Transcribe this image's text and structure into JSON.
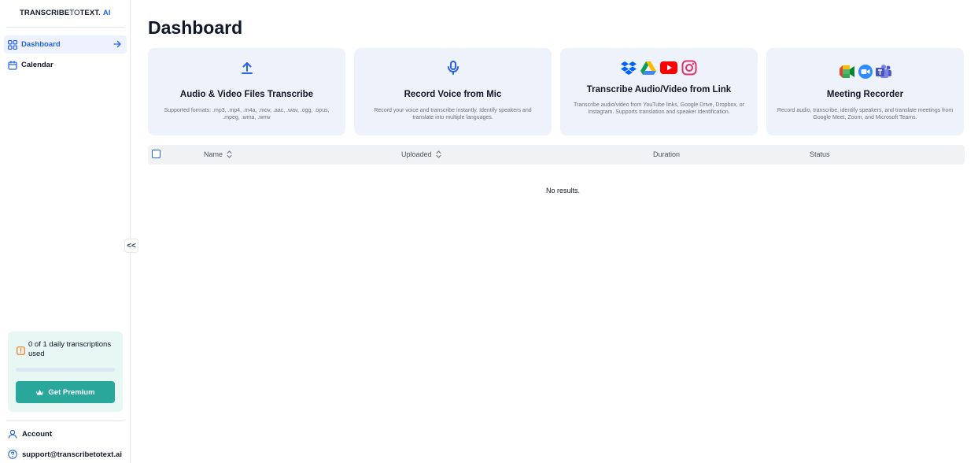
{
  "logo": {
    "part1": "TRANSCRIBE",
    "part2": "TO",
    "part3": "TEXT.",
    "part4": "AI"
  },
  "sidebar": {
    "items": [
      {
        "label": "Dashboard",
        "icon": "grid-icon",
        "active": true
      },
      {
        "label": "Calendar",
        "icon": "calendar-icon",
        "active": false
      }
    ],
    "collapse_label": "<<",
    "usage": {
      "text": "0 of 1 daily transcriptions used",
      "used": 0,
      "limit": 1,
      "fill_fraction": 0
    },
    "premium_label": "Get Premium",
    "account_label": "Account",
    "support_label": "support@transcribetotext.ai"
  },
  "main": {
    "title": "Dashboard",
    "cards": [
      {
        "title": "Audio & Video Files Transcribe",
        "desc": "Supported formats: .mp3, .mp4, .m4a, .mov, .aac, .wav, .ogg, .opus, .mpeg, .wma, .wmv",
        "icons": [
          "upload-icon"
        ]
      },
      {
        "title": "Record Voice from Mic",
        "desc": "Record your voice and transcribe instantly. Identify speakers and translate into multiple languages.",
        "icons": [
          "microphone-icon"
        ]
      },
      {
        "title": "Transcribe Audio/Video from Link",
        "desc": "Transcribe audio/video from YouTube links, Google Drive, Dropbox, or Instagram. Supports translation and speaker identification.",
        "icons": [
          "dropbox-icon",
          "google-drive-icon",
          "youtube-icon",
          "instagram-icon"
        ]
      },
      {
        "title": "Meeting Recorder",
        "desc": "Record audio, transcribe, identify speakers, and translate meetings from Google Meet, Zoom, and Microsoft Teams.",
        "icons": [
          "google-meet-icon",
          "zoom-icon",
          "microsoft-teams-icon"
        ]
      }
    ],
    "table": {
      "columns": [
        "Name",
        "Uploaded",
        "Duration",
        "Status"
      ],
      "empty_text": "No results."
    }
  },
  "colors": {
    "accent": "#2563eb",
    "premium": "#2aa79b",
    "card_bg": "#eef2fb",
    "usage_bg": "#e6f7f4"
  }
}
